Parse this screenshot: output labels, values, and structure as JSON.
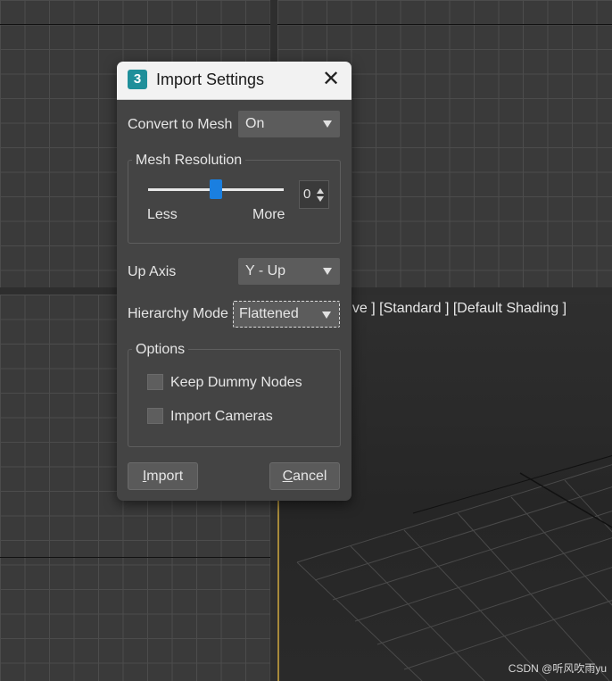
{
  "viewport": {
    "label": "ective ]  [Standard ]  [Default Shading ]"
  },
  "dialog": {
    "title": "Import Settings",
    "app_icon": "3ds-max-icon",
    "close_icon": "✕",
    "convert_to_mesh": {
      "label": "Convert to Mesh",
      "value": "On"
    },
    "mesh_resolution": {
      "title": "Mesh Resolution",
      "slider_level": 0.5,
      "less_label": "Less",
      "more_label": "More",
      "spinner_value": "0"
    },
    "up_axis": {
      "label": "Up Axis",
      "value": "Y - Up"
    },
    "hierarchy_mode": {
      "label": "Hierarchy Mode",
      "value": "Flattened"
    },
    "options": {
      "title": "Options",
      "items": [
        {
          "label": "Keep Dummy Nodes",
          "checked": false
        },
        {
          "label": "Import Cameras",
          "checked": false
        }
      ]
    },
    "buttons": {
      "import_first": "I",
      "import_rest": "mport",
      "cancel_first": "C",
      "cancel_rest": "ancel"
    }
  },
  "watermark": "CSDN @听风吹雨yu",
  "colors": {
    "accent": "#1a7fe0",
    "dialog_bg": "#444444",
    "viewport_border": "#a78a3a"
  }
}
